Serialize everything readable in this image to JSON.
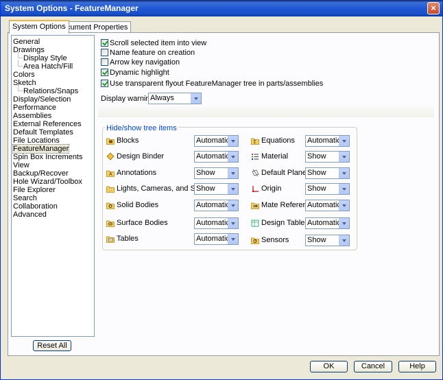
{
  "window": {
    "title": "System Options - FeatureManager",
    "close_label": "×"
  },
  "tabs": [
    {
      "label": "System Options"
    },
    {
      "label": "Document Properties"
    }
  ],
  "nav": {
    "items": [
      "General",
      "Drawings",
      "Display Style",
      "Area Hatch/Fill",
      "Colors",
      "Sketch",
      "Relations/Snaps",
      "Display/Selection",
      "Performance",
      "Assemblies",
      "External References",
      "Default Templates",
      "File Locations",
      "FeatureManager",
      "Spin Box Increments",
      "View",
      "Backup/Recover",
      "Hole Wizard/Toolbox",
      "File Explorer",
      "Search",
      "Collaboration",
      "Advanced"
    ],
    "selected": "FeatureManager",
    "reset_label": "Reset All"
  },
  "options": [
    {
      "label": "Scroll selected item into view",
      "checked": true
    },
    {
      "label": "Name feature on creation",
      "checked": false
    },
    {
      "label": "Arrow key navigation",
      "checked": false
    },
    {
      "label": "Dynamic highlight",
      "checked": true
    },
    {
      "label": "Use transparent flyout FeatureManager tree in parts/assemblies",
      "checked": true
    }
  ],
  "display_warnings": {
    "label": "Display warnings:",
    "value": "Always"
  },
  "tree_items": {
    "title": "Hide/show tree items",
    "left": [
      {
        "label": "Blocks",
        "value": "Automatic",
        "icon": "blocks-icon"
      },
      {
        "label": "Design Binder",
        "value": "Automatic",
        "icon": "design-binder-icon"
      },
      {
        "label": "Annotations",
        "value": "Show",
        "icon": "annotations-icon"
      },
      {
        "label": "Lights, Cameras, and Scene",
        "value": "Show",
        "icon": "lights-folder-icon"
      },
      {
        "label": "Solid Bodies",
        "value": "Automatic",
        "icon": "solid-bodies-icon"
      },
      {
        "label": "Surface Bodies",
        "value": "Automatic",
        "icon": "surface-bodies-icon"
      },
      {
        "label": "Tables",
        "value": "Automatic",
        "icon": "tables-icon"
      }
    ],
    "right": [
      {
        "label": "Equations",
        "value": "Automatic",
        "icon": "equations-icon"
      },
      {
        "label": "Material",
        "value": "Show",
        "icon": "material-icon"
      },
      {
        "label": "Default Planes",
        "value": "Show",
        "icon": "default-planes-icon"
      },
      {
        "label": "Origin",
        "value": "Show",
        "icon": "origin-icon"
      },
      {
        "label": "Mate References",
        "value": "Automatic",
        "icon": "mate-references-icon"
      },
      {
        "label": "Design Table",
        "value": "Automatic",
        "icon": "design-table-icon"
      },
      {
        "label": "Sensors",
        "value": "Show",
        "icon": "sensors-icon"
      }
    ]
  },
  "buttons": {
    "ok": "OK",
    "cancel": "Cancel",
    "help": "Help"
  },
  "colors": {
    "titlebar": "#2158d4",
    "group_title": "#0046d5",
    "check": "#21a121",
    "folder": "#f7cf5a"
  }
}
